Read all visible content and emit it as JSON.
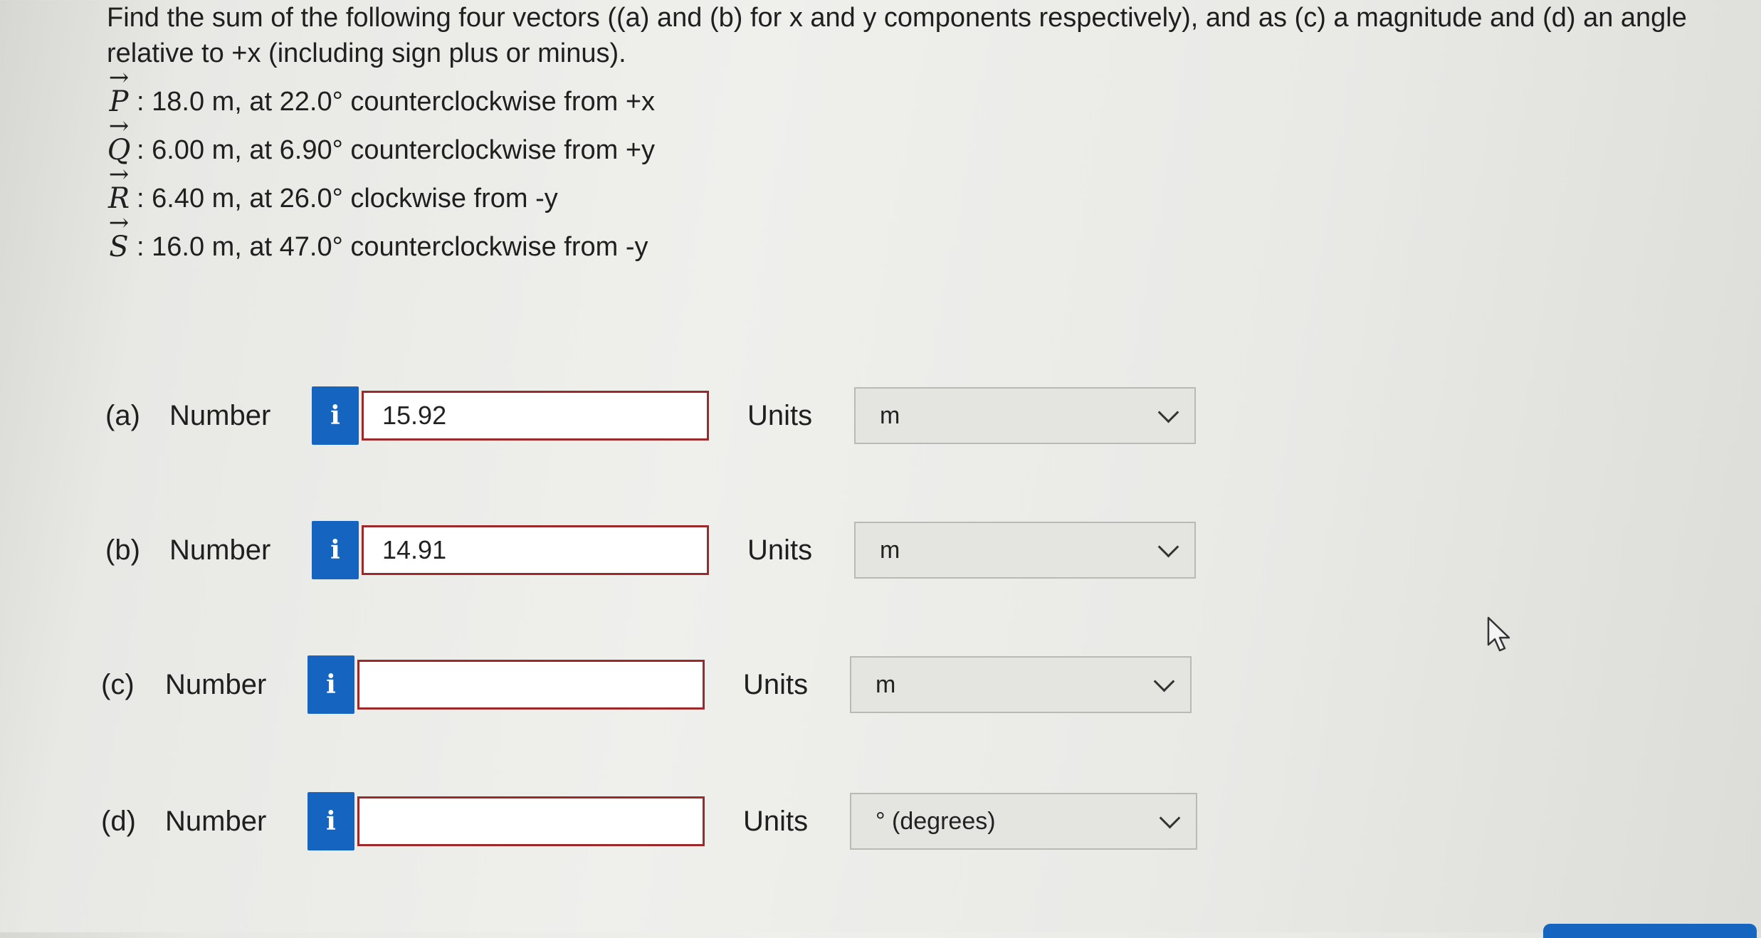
{
  "question": {
    "intro": "Find the sum of the following four vectors ((a) and (b) for x and y components respectively), and as (c) a magnitude and (d) an angle relative to +x (including sign plus or minus).",
    "vectors": [
      {
        "symbol": "P",
        "text": ": 18.0 m, at 22.0° counterclockwise from +x"
      },
      {
        "symbol": "Q",
        "text": ": 6.00 m, at 6.90° counterclockwise from +y"
      },
      {
        "symbol": "R",
        "text": ": 6.40 m, at 26.0° clockwise from -y"
      },
      {
        "symbol": "S",
        "text": ": 16.0 m, at 47.0° counterclockwise from -y"
      }
    ]
  },
  "answers": [
    {
      "part": "(a)",
      "number_label": "Number",
      "info_icon": "i",
      "value": "15.92",
      "units_label": "Units",
      "unit": "m"
    },
    {
      "part": "(b)",
      "number_label": "Number",
      "info_icon": "i",
      "value": "14.91",
      "units_label": "Units",
      "unit": "m"
    },
    {
      "part": "(c)",
      "number_label": "Number",
      "info_icon": "i",
      "value": "",
      "units_label": "Units",
      "unit": "m"
    },
    {
      "part": "(d)",
      "number_label": "Number",
      "info_icon": "i",
      "value": "",
      "units_label": "Units",
      "unit": "° (degrees)"
    }
  ],
  "colors": {
    "info_button": "#1565c0",
    "input_border": "#9c2a2a"
  }
}
